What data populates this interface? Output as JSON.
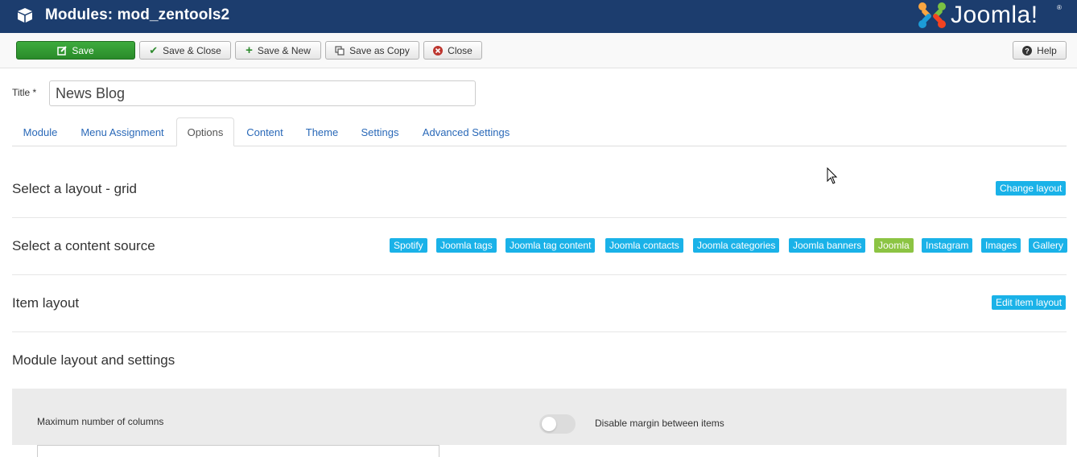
{
  "header": {
    "title": "Modules: mod_zentools2",
    "brand": "Joomla!",
    "brand_reg": "®"
  },
  "toolbar": {
    "save_label": "Save",
    "save_close_label": "Save & Close",
    "save_new_label": "Save & New",
    "save_copy_label": "Save as Copy",
    "close_label": "Close",
    "help_label": "Help"
  },
  "form": {
    "title_label": "Title *",
    "title_value": "News Blog"
  },
  "tabs": [
    {
      "label": "Module"
    },
    {
      "label": "Menu Assignment"
    },
    {
      "label": "Options",
      "active": true
    },
    {
      "label": "Content"
    },
    {
      "label": "Theme"
    },
    {
      "label": "Settings"
    },
    {
      "label": "Advanced Settings"
    }
  ],
  "sections": {
    "layout": {
      "title": "Select a layout - grid",
      "action": "Change layout"
    },
    "source": {
      "title": "Select a content source",
      "options": [
        "Spotify",
        "Joomla tags",
        "Joomla tag content",
        "Joomla contacts",
        "Joomla categories",
        "Joomla banners",
        "Joomla",
        "Instagram",
        "Images",
        "Gallery"
      ],
      "selected": "Joomla"
    },
    "item_layout": {
      "title": "Item layout",
      "action": "Edit item layout"
    },
    "module_layout": {
      "title": "Module layout and settings"
    }
  },
  "panel": {
    "max_columns_label": "Maximum number of columns",
    "max_columns_value": "",
    "disable_margin_label": "Disable margin between items",
    "disable_margin_on": false
  },
  "colors": {
    "header_bg": "#1c3d6e",
    "badge_blue": "#1ab2e8",
    "badge_green": "#8cc443",
    "save_green": "#2f9a2f"
  }
}
